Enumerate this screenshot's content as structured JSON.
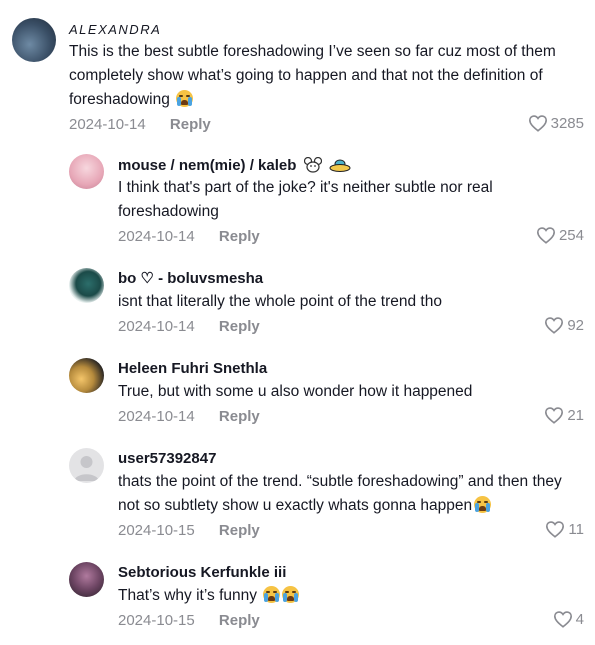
{
  "comments": [
    {
      "username": "ALEXANDRA",
      "text": "This is the best subtle foreshadowing I’ve seen so far cuz most of them completely show what’s going to happen and that not the definition of foreshadowing",
      "date": "2024-10-14",
      "reply": "Reply",
      "likes": "3285",
      "avatar_colors": [
        "#5b7690",
        "#2c3e55"
      ]
    },
    {
      "username": "mouse / nem(mie) / kaleb",
      "text": "I think that's part of the joke? it's neither subtle nor real foreshadowing",
      "date": "2024-10-14",
      "reply": "Reply",
      "likes": "254",
      "avatar_colors": [
        "#f2c4cf",
        "#d88aa0"
      ]
    },
    {
      "username": "bo ♡ - boluvsmesha",
      "text": "isnt that literally the whole point of the trend tho",
      "date": "2024-10-14",
      "reply": "Reply",
      "likes": "92",
      "avatar_colors": [
        "#e8f2f1",
        "#1f5c5a"
      ]
    },
    {
      "username": "Heleen Fuhri Snethla",
      "text": "True, but with some u also wonder how it happened",
      "date": "2024-10-14",
      "reply": "Reply",
      "likes": "21",
      "avatar_colors": [
        "#f0c36b",
        "#2a2622"
      ]
    },
    {
      "username": "user57392847",
      "text": "thats the point of the trend. “subtle foreshadowing” and then they not so subtlety show u exactly whats gonna happen",
      "date": "2024-10-15",
      "reply": "Reply",
      "likes": "11",
      "avatar_colors": [
        "#e3e3e5",
        "#c4c4c8"
      ]
    },
    {
      "username": "Sebtorious Kerfunkle iii",
      "text": "That’s why it’s funny",
      "date": "2024-10-15",
      "reply": "Reply",
      "likes": "4",
      "avatar_colors": [
        "#8a5b7c",
        "#2f2430"
      ]
    }
  ],
  "icons": {
    "like": "heart-outline-icon",
    "emoji_cry": "loudly-crying-face-emoji",
    "emoji_mouse": "mouse-face-emoji",
    "emoji_ufo": "flying-saucer-emoji"
  }
}
